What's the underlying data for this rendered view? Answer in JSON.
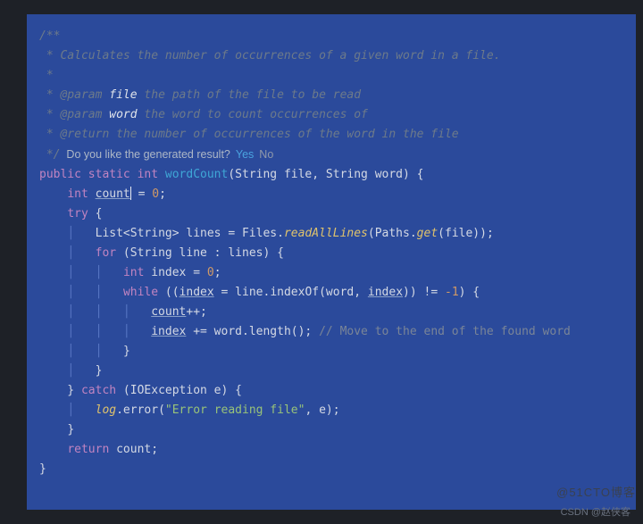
{
  "doc": {
    "open": "/**",
    "l1": " * Calculates the number of occurrences of a given word in a file.",
    "l2": " *",
    "l3a": " * ",
    "l3tag": "@param",
    "l3name": " file",
    "l3rest": " the path of the file to be read",
    "l4a": " * ",
    "l4tag": "@param",
    "l4name": " word",
    "l4rest": " the word to count occurrences of",
    "l5a": " * ",
    "l5tag": "@return",
    "l5rest": " the number of occurrences of the word in the file",
    "close": " */"
  },
  "prompt": {
    "text": "  Do you like the generated result?",
    "yes": "Yes",
    "no": "No"
  },
  "sig": {
    "mods": "public static ",
    "rettype": "int ",
    "name": "wordCount",
    "params": "(String file, String word) {"
  },
  "body": {
    "decl_kw": "int ",
    "decl_var": "count",
    "decl_rest": " = ",
    "decl_zero": "0",
    "decl_semi": ";",
    "try": "try",
    "try_brace": " {",
    "list_pre": "List<String> lines = Files.",
    "list_m": "readAllLines",
    "list_mid": "(Paths.",
    "list_m2": "get",
    "list_post": "(file));",
    "for": "for",
    "for_rest": " (String line : lines) {",
    "idx_kw": "int ",
    "idx_rest": "index = ",
    "idx_zero": "0",
    "idx_semi": ";",
    "while": "while",
    "while_open": " ((",
    "while_idx": "index",
    "while_eq": " = line.indexOf(word, ",
    "while_idx2": "index",
    "while_close": ")) != ",
    "while_neg1": "-1",
    "while_brace": ") {",
    "countpp": "count",
    "countpp_rest": "++;",
    "idx_add": "index",
    "idx_add_rest": " += word.length(); ",
    "idx_add_comment": "// Move to the end of the found word",
    "close_brace": "}",
    "catch": "catch",
    "catch_rest": " (IOException e) {",
    "log": "log",
    "log_dot": ".error(",
    "log_str": "\"Error reading file\"",
    "log_rest": ", e);",
    "return": "return",
    "return_rest": " count;"
  },
  "watermark": {
    "faint": "@51CTO博客",
    "bright": "CSDN @赵侠客"
  }
}
